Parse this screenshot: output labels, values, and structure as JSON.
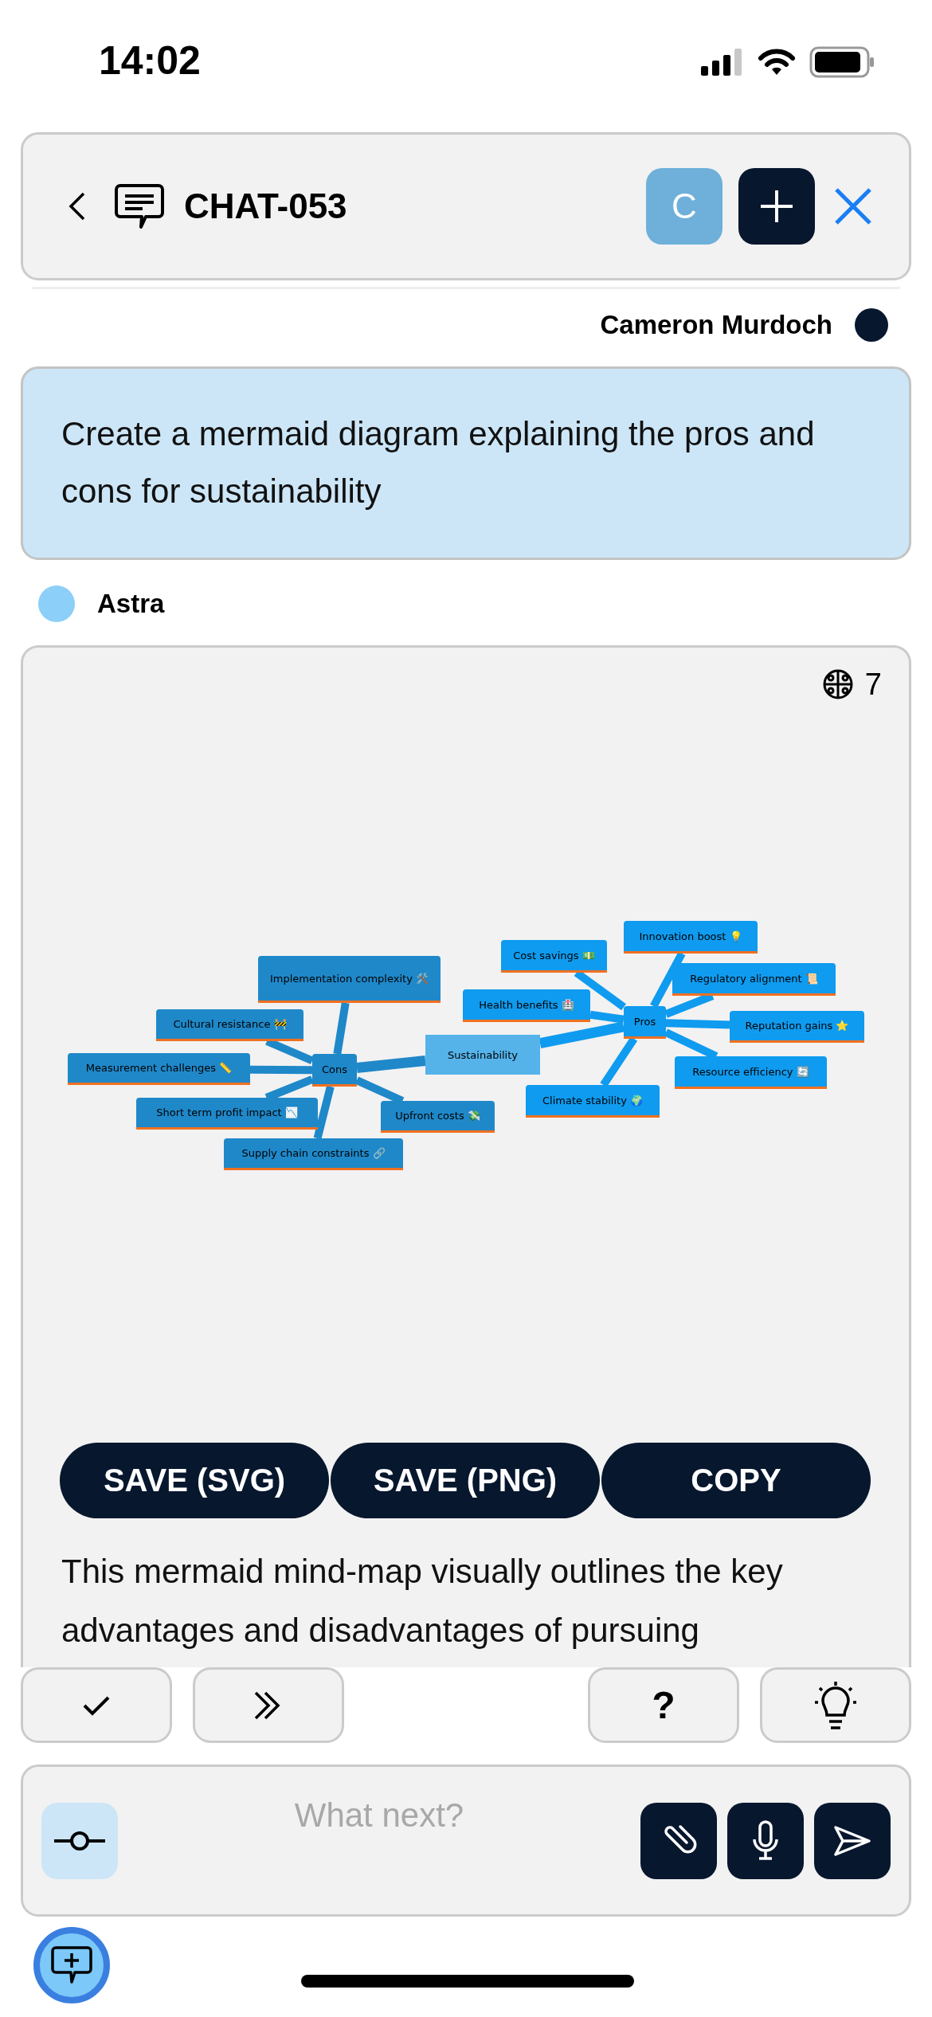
{
  "status_bar": {
    "time": "14:02"
  },
  "header": {
    "title": "CHAT-053",
    "avatar": "C"
  },
  "user_message": {
    "author": "Cameron Murdoch",
    "text": "Create a mermaid diagram explaining the pros and cons for sustainability"
  },
  "assistant_message": {
    "author": "Astra",
    "badge_count": "7",
    "diagram": {
      "label": "Sustainability",
      "children": [
        {
          "label": "Pros",
          "color": "#0f9bef",
          "children": [
            {
              "label": "Cost savings 💵"
            },
            {
              "label": "Innovation boost 💡"
            },
            {
              "label": "Health benefits 🏥"
            },
            {
              "label": "Regulatory alignment 📜"
            },
            {
              "label": "Reputation gains ⭐"
            },
            {
              "label": "Resource efficiency 🔄"
            },
            {
              "label": "Climate stability 🌍"
            }
          ]
        },
        {
          "label": "Cons",
          "color": "#1f88c9",
          "children": [
            {
              "label": "Implementation complexity 🛠️"
            },
            {
              "label": "Cultural resistance 🚧"
            },
            {
              "label": "Measurement challenges 📏"
            },
            {
              "label": "Short term profit impact 📉"
            },
            {
              "label": "Upfront costs 💸"
            },
            {
              "label": "Supply chain constraints 🔗"
            }
          ]
        }
      ]
    },
    "actions": [
      "SAVE (SVG)",
      "SAVE (PNG)",
      "COPY"
    ],
    "text": "This mermaid mind-map visually outlines the key advantages and disadvantages of pursuing"
  },
  "toolbar": {
    "help": "?"
  },
  "composer": {
    "placeholder": "What next?"
  }
}
